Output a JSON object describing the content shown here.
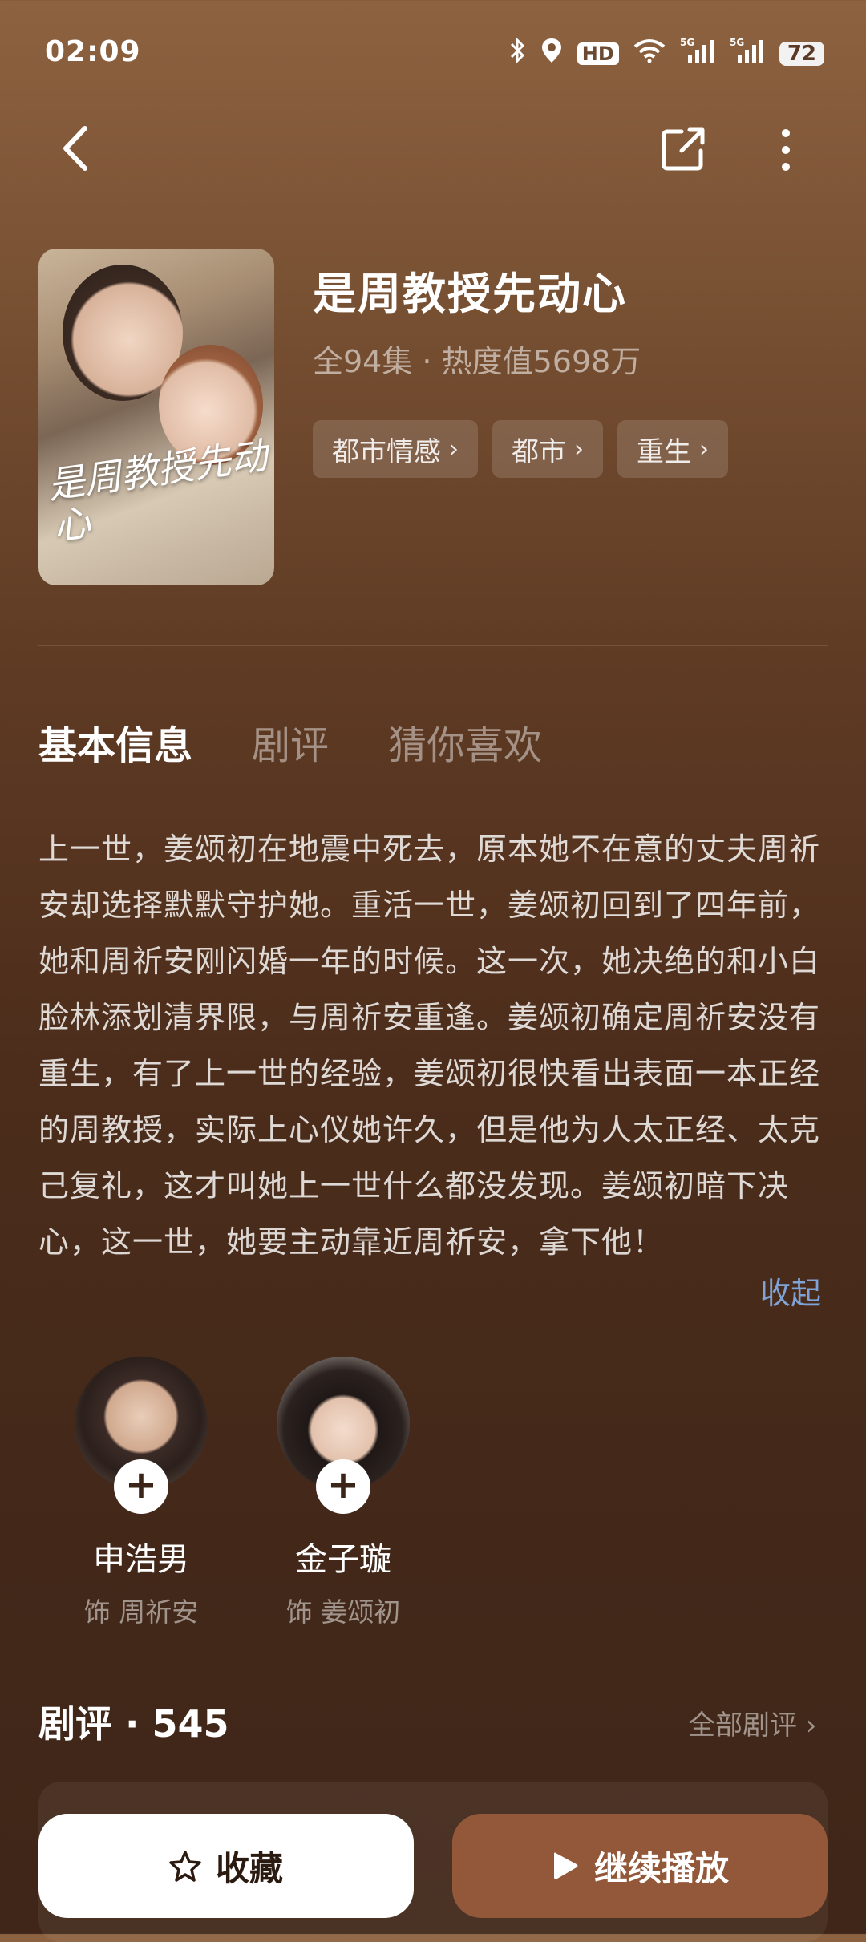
{
  "status_bar": {
    "time": "02:09",
    "hd_label": "HD",
    "network_1": "5G",
    "network_2": "5G",
    "battery": "72",
    "icons": [
      "bluetooth-icon",
      "location-icon",
      "hd-icon",
      "wifi-icon",
      "signal-5g-icon",
      "signal-5g-icon",
      "battery-icon"
    ]
  },
  "header": {
    "back_icon": "chevron-left-icon",
    "share_icon": "share-icon",
    "more_icon": "more-vertical-icon"
  },
  "show": {
    "title": "是周教授先动心",
    "meta": "全94集 ·          热度值5698万",
    "poster_text": "是周教授先动心",
    "tags": [
      {
        "label": "都市情感"
      },
      {
        "label": "都市"
      },
      {
        "label": "重生"
      }
    ]
  },
  "tabs": [
    {
      "label": "基本信息",
      "active": true
    },
    {
      "label": "剧评",
      "active": false
    },
    {
      "label": "猜你喜欢",
      "active": false
    }
  ],
  "synopsis": {
    "text": "上一世，姜颂初在地震中死去，原本她不在意的丈夫周祈安却选择默默守护她。重活一世，姜颂初回到了四年前，她和周祈安刚闪婚一年的时候。这一次，她决绝的和小白脸林添划清界限，与周祈安重逢。姜颂初确定周祈安没有重生，有了上一世的经验，姜颂初很快看出表面一本正经的周教授，实际上心仪她许久，但是他为人太正经、太克己复礼，这才叫她上一世什么都没发现。姜颂初暗下决心，这一世，她要主动靠近周祈安，拿下他！",
    "collapse_label": "收起"
  },
  "cast": [
    {
      "name": "申浩男",
      "role": "饰 周祈安",
      "follow": "+"
    },
    {
      "name": "金子璇",
      "role": "饰 姜颂初",
      "follow": "+"
    }
  ],
  "reviews": {
    "title": "剧评 · 545",
    "all_label": "全部剧评"
  },
  "actions": {
    "favorite_label": "收藏",
    "play_label": "继续播放"
  }
}
